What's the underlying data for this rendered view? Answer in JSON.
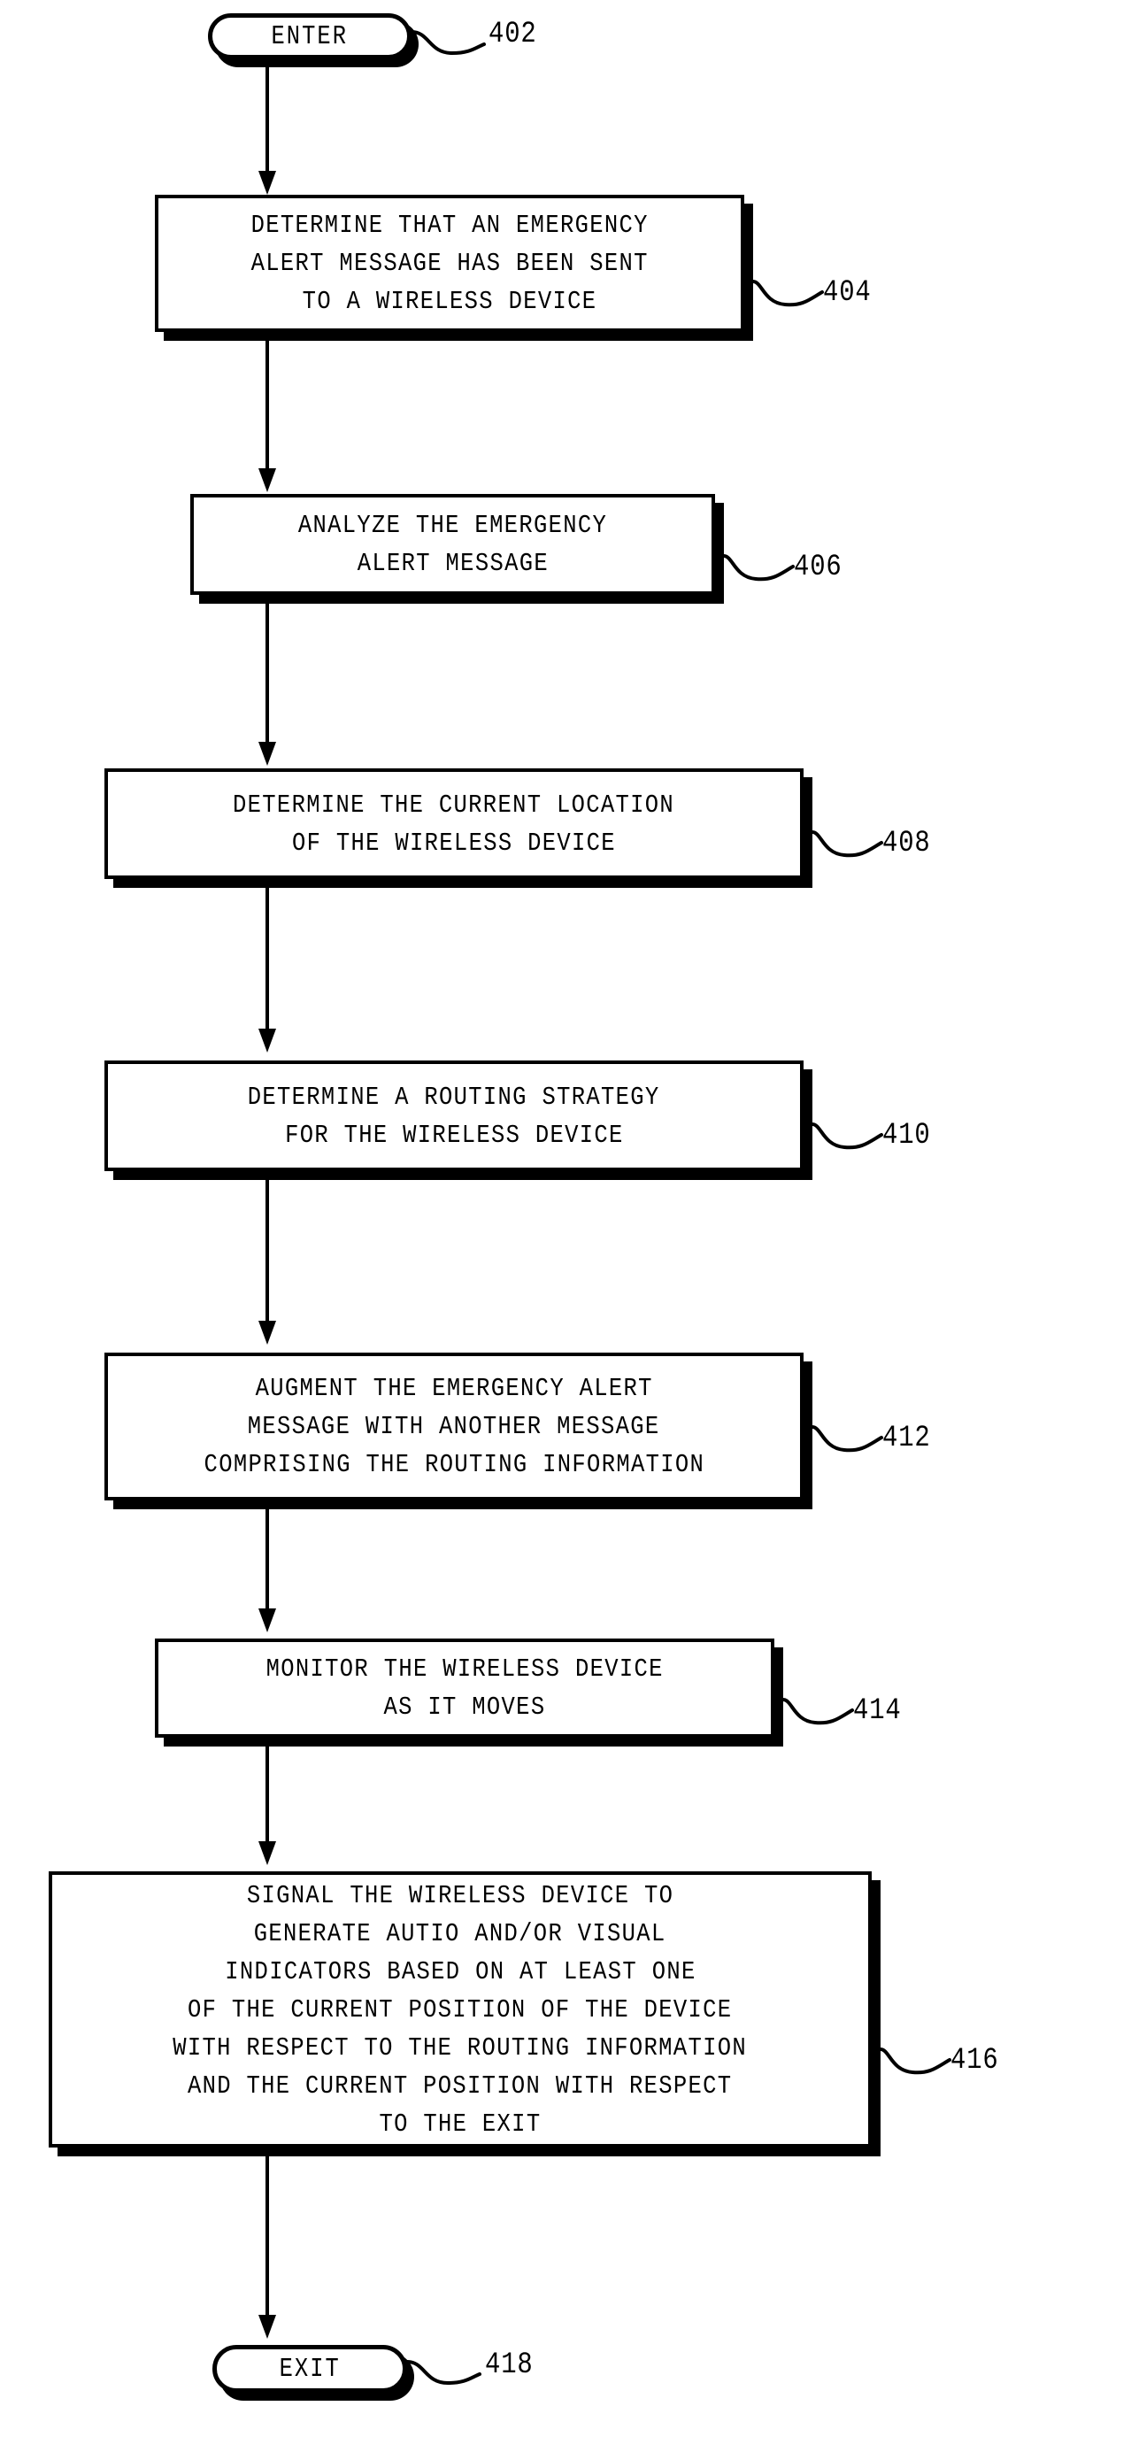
{
  "figure": {
    "type": "patent-flowchart",
    "nodes": [
      {
        "id": "enter",
        "shape": "terminal",
        "label": "ENTER",
        "ref": "402"
      },
      {
        "id": "step404",
        "shape": "process",
        "ref": "404",
        "lines": [
          "DETERMINE THAT AN EMERGENCY",
          "ALERT MESSAGE HAS BEEN SENT",
          "TO A WIRELESS DEVICE"
        ]
      },
      {
        "id": "step406",
        "shape": "process",
        "ref": "406",
        "lines": [
          "ANALYZE THE EMERGENCY",
          "ALERT MESSAGE"
        ]
      },
      {
        "id": "step408",
        "shape": "process",
        "ref": "408",
        "lines": [
          "DETERMINE THE CURRENT LOCATION",
          "OF THE WIRELESS DEVICE"
        ]
      },
      {
        "id": "step410",
        "shape": "process",
        "ref": "410",
        "lines": [
          "DETERMINE A ROUTING STRATEGY",
          "FOR THE WIRELESS DEVICE"
        ]
      },
      {
        "id": "step412",
        "shape": "process",
        "ref": "412",
        "lines": [
          "AUGMENT THE EMERGENCY ALERT",
          "MESSAGE WITH ANOTHER MESSAGE",
          "COMPRISING THE ROUTING INFORMATION"
        ]
      },
      {
        "id": "step414",
        "shape": "process",
        "ref": "414",
        "lines": [
          "MONITOR THE WIRELESS DEVICE",
          "AS IT MOVES"
        ]
      },
      {
        "id": "step416",
        "shape": "process",
        "ref": "416",
        "lines": [
          "SIGNAL THE WIRELESS DEVICE TO",
          "GENERATE AUTIO AND/OR VISUAL",
          "INDICATORS BASED ON AT LEAST ONE",
          "OF THE CURRENT POSITION OF THE DEVICE",
          "WITH RESPECT TO THE ROUTING INFORMATION",
          "AND THE CURRENT POSITION WITH RESPECT",
          "TO THE EXIT"
        ]
      },
      {
        "id": "exit",
        "shape": "terminal",
        "label": "EXIT",
        "ref": "418"
      }
    ],
    "colors": {
      "stroke": "#000000",
      "fill": "#ffffff"
    }
  }
}
